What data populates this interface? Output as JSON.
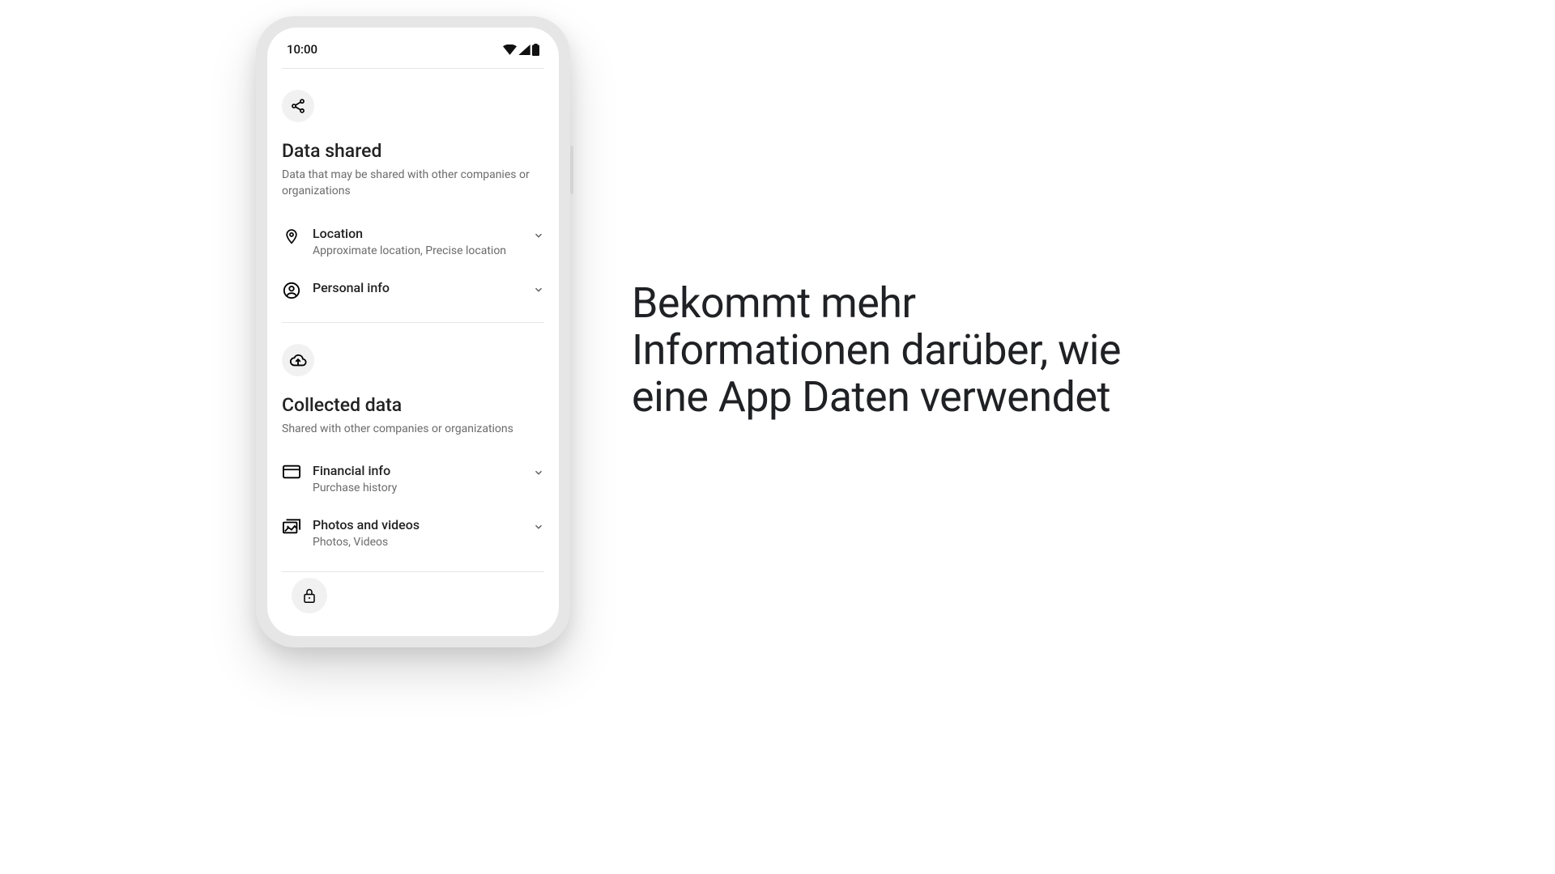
{
  "statusbar": {
    "time": "10:00"
  },
  "sections": {
    "shared": {
      "title": "Data shared",
      "subtitle": "Data that may be shared with other companies or organizations",
      "items": [
        {
          "title": "Location",
          "subtitle": "Approximate location, Precise location"
        },
        {
          "title": "Personal info",
          "subtitle": ""
        }
      ]
    },
    "collected": {
      "title": "Collected data",
      "subtitle": "Shared with other companies or organizations",
      "items": [
        {
          "title": "Financial info",
          "subtitle": "Purchase history"
        },
        {
          "title": "Photos and videos",
          "subtitle": "Photos, Videos"
        }
      ]
    }
  },
  "headline": "Bekommt mehr Informationen darüber, wie eine App Daten verwendet"
}
